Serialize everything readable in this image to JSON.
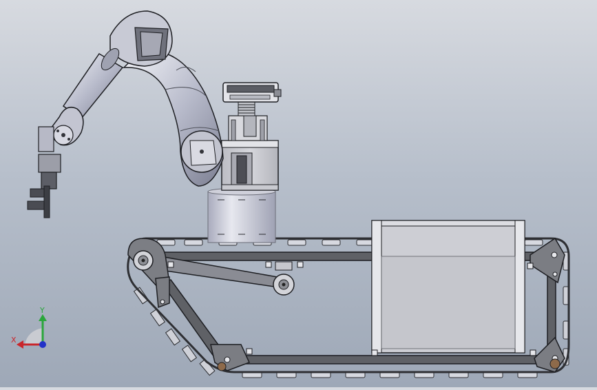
{
  "viewport": {
    "background_top": "#d7dae0",
    "background_bottom": "#9ea8b7"
  },
  "model_colors": {
    "metal_light": "#e8e9ee",
    "metal_mid": "#b9bccb",
    "metal_dark": "#6d7080",
    "frame": "#5c5e63",
    "outline": "#1d1e22",
    "panel": "#cfd0d6"
  },
  "triad": {
    "x_label": "X",
    "y_label": "Y",
    "x_color": "#c9262b",
    "y_color": "#2aa63b",
    "z_color": "#2232c8"
  }
}
